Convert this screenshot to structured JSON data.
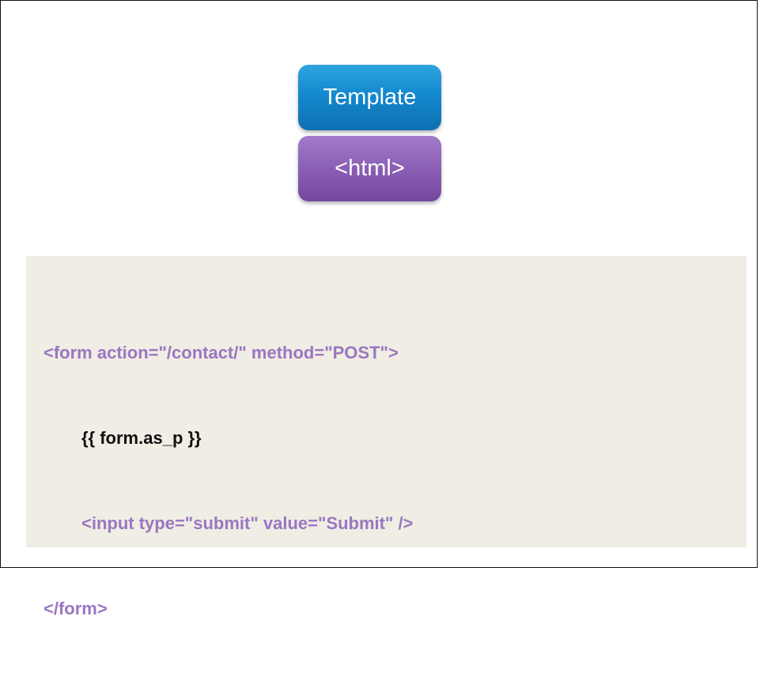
{
  "diagram": {
    "template_label": "Template",
    "html_label": "<html>",
    "colors": {
      "template_box": "#1489ce",
      "html_box": "#8a5fb5",
      "code_background": "#efede4",
      "markup_text": "#9b76c1",
      "template_tag_text": "#111111"
    }
  },
  "code": {
    "lines": [
      "<form action=\"/contact/\" method=\"POST\">",
      "{{ form.as_p }}",
      "<input type=\"submit\" value=\"Submit\" />",
      "</form>"
    ]
  }
}
